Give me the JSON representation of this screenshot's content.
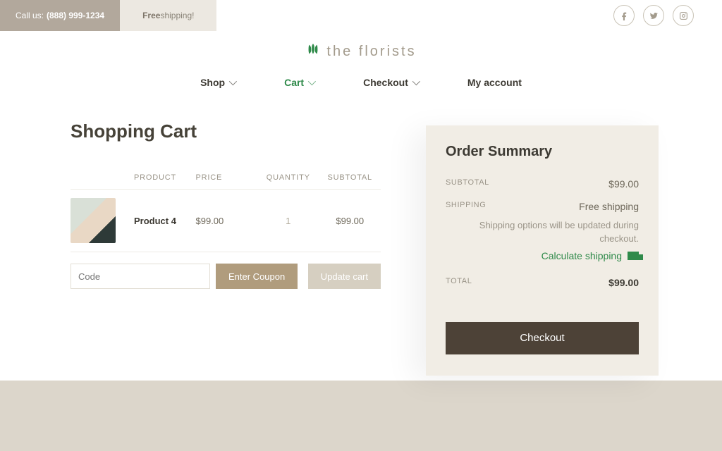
{
  "utility": {
    "call_label": "Call us:",
    "phone": "(888) 999-1234",
    "free_bold": "Free",
    "free_rest": " shipping!"
  },
  "brand": {
    "name": "the florists"
  },
  "nav": {
    "shop": "Shop",
    "cart": "Cart",
    "checkout": "Checkout",
    "account": "My account"
  },
  "page_title": "Shopping Cart",
  "thead": {
    "product": "PRODUCT",
    "price": "PRICE",
    "quantity": "QUANTITY",
    "subtotal": "SUBTOTAL"
  },
  "row": {
    "name": "Product 4",
    "price": "$99.00",
    "qty": "1",
    "subtotal": "$99.00"
  },
  "coupon": {
    "placeholder": "Code",
    "enter": "Enter Coupon",
    "update": "Update cart"
  },
  "summary": {
    "title": "Order Summary",
    "subtotal_label": "SUBTOTAL",
    "subtotal_value": "$99.00",
    "shipping_label": "SHIPPING",
    "shipping_value": "Free shipping",
    "shipping_note": "Shipping options will be updated during checkout.",
    "calc": "Calculate shipping",
    "total_label": "TOTAL",
    "total_value": "$99.00",
    "checkout": "Checkout"
  }
}
